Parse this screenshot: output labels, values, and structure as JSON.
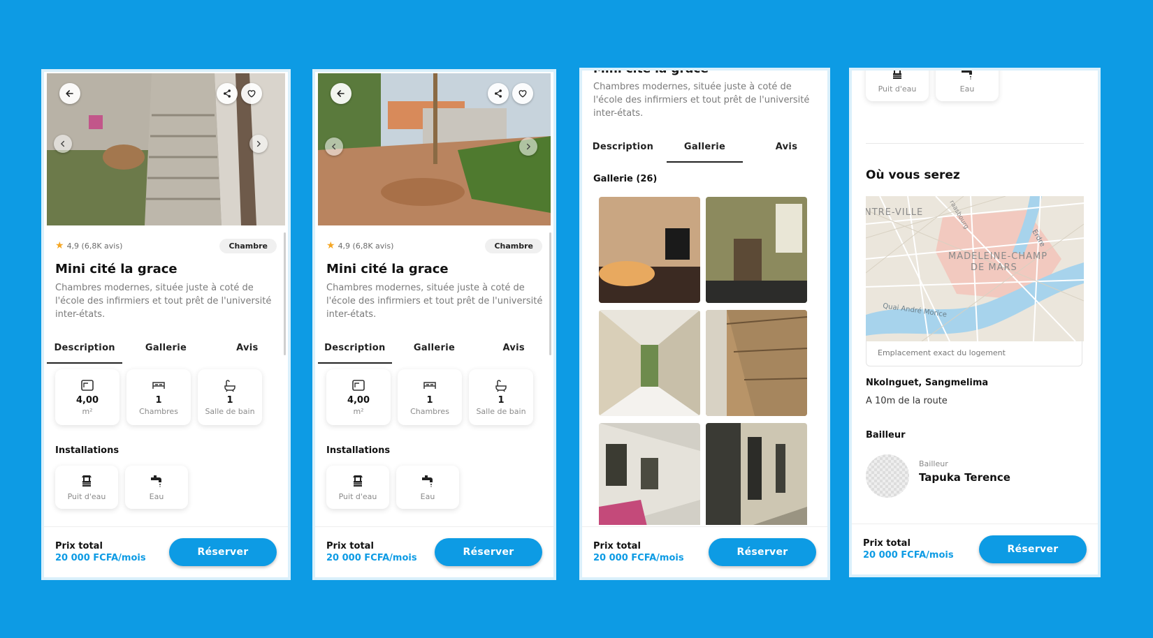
{
  "listing": {
    "rating": "4,9 (6,8K avis)",
    "category": "Chambre",
    "title": "Mini cité la grace",
    "title_cut": "Mini cité la grace",
    "description": "Chambres modernes, située juste à coté de l'école des infirmiers et tout prêt de l'université inter-états."
  },
  "tabs": [
    "Description",
    "Gallerie",
    "Avis"
  ],
  "stats": [
    {
      "value": "4,00",
      "unit": "m²",
      "icon": "area-icon"
    },
    {
      "value": "1",
      "unit": "Chambres",
      "icon": "bed-icon"
    },
    {
      "value": "1",
      "unit": "Salle de bain",
      "icon": "bathtub-icon"
    }
  ],
  "installations": {
    "heading": "Installations",
    "items": [
      {
        "label": "Puit d'eau",
        "icon": "well-icon"
      },
      {
        "label": "Eau",
        "icon": "faucet-icon"
      }
    ]
  },
  "gallery": {
    "heading": "Gallerie (26)"
  },
  "location": {
    "heading": "Où vous serez",
    "map_labels": [
      "NTRE-VILLE",
      "MADELEINE-CHAMP",
      "DE MARS",
      "Quai André Morice",
      "Erdre",
      "raasbourg"
    ],
    "map_caption": "Emplacement exact du logement",
    "address": "Nkolnguet, Sangmelima",
    "distance": "A 10m de la route"
  },
  "landlord": {
    "heading": "Bailleur",
    "role": "Bailleur",
    "name": "Tapuka Terence"
  },
  "booking": {
    "price_label": "Prix total",
    "price": "20 000 FCFA/mois",
    "button": "Réserver"
  },
  "colors": {
    "accent": "#0d9be4",
    "star": "#f5a623"
  }
}
